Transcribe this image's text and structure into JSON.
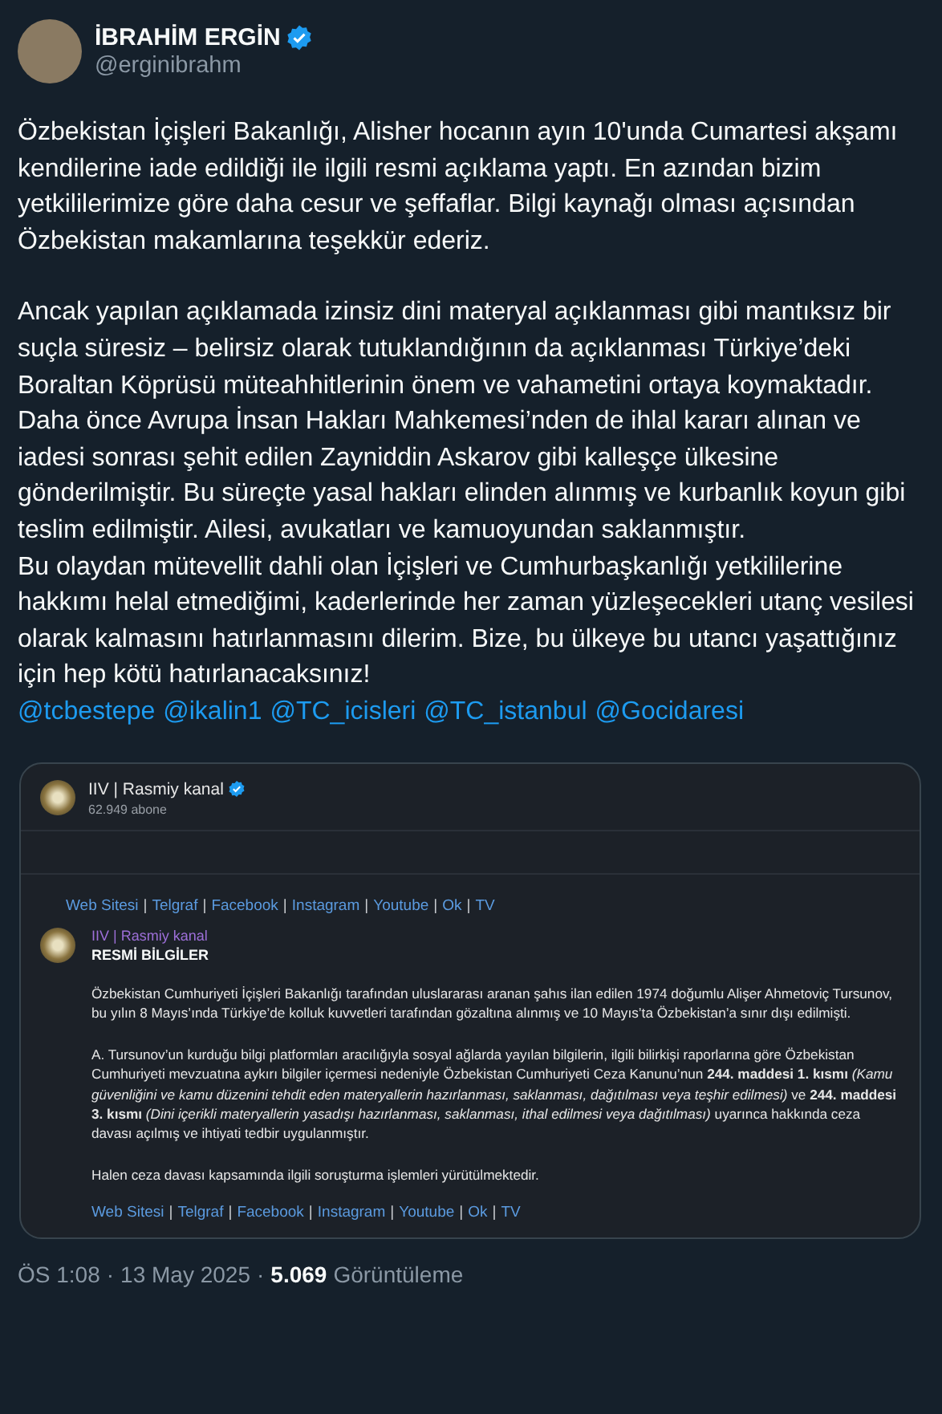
{
  "author": {
    "name": "İBRAHİM ERGİN",
    "verified": true,
    "handle": "@erginibrahm"
  },
  "paragraphs": [
    "Özbekistan İçişleri Bakanlığı, Alisher hocanın ayın 10'unda Cumartesi akşamı kendilerine iade edildiği ile ilgili resmi açıklama yaptı. En azından bizim yetkililerimize göre daha cesur ve şeffaflar. Bilgi kaynağı olması açısından Özbekistan makamlarına teşekkür ederiz.",
    "Ancak yapılan açıklamada izinsiz dini materyal açıklanması gibi mantıksız bir suçla süresiz – belirsiz olarak tutuklandığının da açıklanması Türkiye’deki Boraltan Köprüsü müteahhitlerinin önem ve vahametini ortaya koymaktadır. Daha önce Avrupa İnsan Hakları Mahkemesi’nden de ihlal kararı alınan ve iadesi sonrası şehit edilen Zayniddin Askarov gibi kalleşçe ülkesine gönderilmiştir. Bu süreçte yasal hakları elinden alınmış ve kurbanlık koyun gibi teslim edilmiştir. Ailesi, avukatları ve kamuoyundan saklanmıştır.\nBu olaydan mütevellit dahli olan İçişleri ve Cumhurbaşkanlığı yetkililerine hakkımı helal etmediğimi, kaderlerinde her zaman yüzleşecekleri utanç vesilesi olarak kalmasını hatırlanmasını dilerim. Bize, bu ülkeye bu utancı yaşattığınız için hep kötü hatırlanacaksınız!"
  ],
  "mentions": [
    "@tcbestepe",
    "@ikalin1",
    "@TC_icisleri",
    "@TC_istanbul",
    "@Gocidaresi"
  ],
  "embed": {
    "channel": {
      "name": "IIV | Rasmiy kanal",
      "verified": true,
      "subscribers": "62.949 abone"
    },
    "links_top": [
      {
        "kind": "link",
        "text": "Web Sitesi"
      },
      {
        "kind": "separator",
        "text": "|"
      },
      {
        "kind": "link",
        "text": "Telgraf"
      },
      {
        "kind": "separator",
        "text": "|"
      },
      {
        "kind": "link",
        "text": "Facebook"
      },
      {
        "kind": "separator",
        "text": "|"
      },
      {
        "kind": "link",
        "text": "Instagram"
      },
      {
        "kind": "separator",
        "text": "|"
      },
      {
        "kind": "link",
        "text": "Youtube"
      },
      {
        "kind": "separator",
        "text": "|"
      },
      {
        "kind": "link",
        "text": "Ok"
      },
      {
        "kind": "separator",
        "text": "|"
      },
      {
        "kind": "link",
        "text": "TV"
      }
    ],
    "message": {
      "sender": "IIV | Rasmiy kanal",
      "title": "RESMİ BİLGİLER",
      "paragraphs": [
        "Özbekistan Cumhuriyeti İçişleri Bakanlığı tarafından uluslararası aranan şahıs ilan edilen 1974 doğumlu Alişer Ahmetoviç Tursunov, bu yılın 8 Mayıs’ında Türkiye’de kolluk kuvvetleri tarafından gözaltına alınmış ve 10 Mayıs’ta Özbekistan’a sınır dışı edilmişti.",
        "A. Tursunov’un kurduğu bilgi platformları aracılığıyla sosyal ağlarda yayılan bilgilerin, ilgili bilirkişi raporlarına göre Özbekistan Cumhuriyeti mevzuatına aykırı bilgiler içermesi nedeniyle Özbekistan Cumhuriyeti Ceza Kanunu’nun **244. maddesi 1. kısmı** *(Kamu güvenliğini ve kamu düzenini tehdit eden materyallerin hazırlanması, saklanması, dağıtılması veya teşhir edilmesi)* ve **244. maddesi 3. kısmı** *(Dini içerikli materyallerin yasadışı hazırlanması, saklanması, ithal edilmesi veya dağıtılması)* uyarınca hakkında ceza davası açılmış ve ihtiyati tedbir uygulanmıştır.",
        "Halen ceza davası kapsamında ilgili soruşturma işlemleri yürütülmektedir."
      ],
      "links": [
        {
          "kind": "link",
          "text": "Web Sitesi"
        },
        {
          "kind": "separator",
          "text": "|"
        },
        {
          "kind": "link",
          "text": "Telgraf"
        },
        {
          "kind": "separator",
          "text": "|"
        },
        {
          "kind": "link",
          "text": "Facebook"
        },
        {
          "kind": "separator",
          "text": "|"
        },
        {
          "kind": "link",
          "text": "Instagram"
        },
        {
          "kind": "separator",
          "text": "|"
        },
        {
          "kind": "link",
          "text": "Youtube"
        },
        {
          "kind": "separator",
          "text": "|"
        },
        {
          "kind": "link",
          "text": "Ok"
        },
        {
          "kind": "separator",
          "text": "|"
        },
        {
          "kind": "link",
          "text": "TV"
        }
      ]
    }
  },
  "footer": {
    "time": "ÖS 1:08",
    "separator_1": "·",
    "date": "13 May 2025",
    "separator_2": "·",
    "views": "5.069",
    "views_label": "Görüntüleme"
  }
}
